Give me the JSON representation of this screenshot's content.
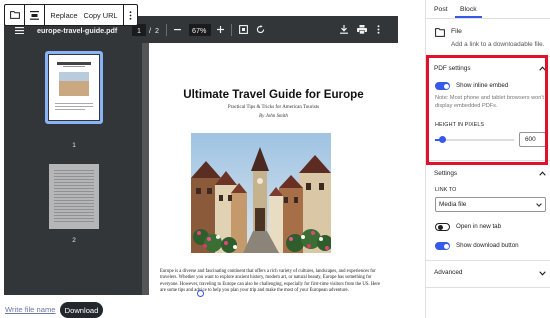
{
  "toolbar": {
    "replace_label": "Replace",
    "copy_url_label": "Copy URL"
  },
  "viewer": {
    "filename": "europe-travel-guide.pdf",
    "current_page": "1",
    "page_sep": "/",
    "page_total": "2",
    "zoom": "67%",
    "thumbnails": [
      {
        "num": "1"
      },
      {
        "num": "2"
      }
    ]
  },
  "page": {
    "title": "Ultimate Travel Guide for Europe",
    "subtitle": "Practical Tips & Tricks for American Tourists",
    "author": "By John Smith",
    "paragraph": "Europe is a diverse and fascinating continent that offers a rich variety of cultures, landscapes, and experiences for travelers. Whether you want to explore ancient history, modern art, or natural beauty, Europe has something for everyone. However, traveling to Europe can also be challenging, especially for first-time visitors from the US. Here are some tips and advice to help you plan your trip and make the most of your European adventure."
  },
  "below": {
    "write_file_name": "Write file name",
    "download_label": "Download"
  },
  "panel": {
    "tabs": [
      "Post",
      "Block"
    ],
    "active_tab": "Block",
    "block_name": "File",
    "block_desc": "Add a link to a downloadable file.",
    "pdf_settings_title": "PDF settings",
    "show_inline_embed": "Show inline embed",
    "show_inline_embed_on": true,
    "inline_note": "Note: Most phone and tablet browsers won't display embedded PDFs.",
    "height_label": "HEIGHT IN PIXELS",
    "height_value": "600",
    "height_slider_fraction": 0.1,
    "settings_title": "Settings",
    "link_to_label": "LINK TO",
    "link_to_value": "Media file",
    "open_new_tab": "Open in new tab",
    "open_new_tab_on": false,
    "show_download_button": "Show download button",
    "show_download_button_on": true,
    "advanced_title": "Advanced"
  },
  "colors": {
    "accent": "#3858e9",
    "highlight_red": "#e0112a",
    "viewer_toolbar": "#323639",
    "viewer_bg": "#525659"
  },
  "icons": [
    "folder-icon",
    "align-icon",
    "more-vertical-icon",
    "menu-icon",
    "zoom-out-icon",
    "zoom-in-icon",
    "fit-page-icon",
    "rotate-icon",
    "download-icon",
    "print-icon",
    "file-icon",
    "chevron-up-icon",
    "chevron-down-icon"
  ]
}
